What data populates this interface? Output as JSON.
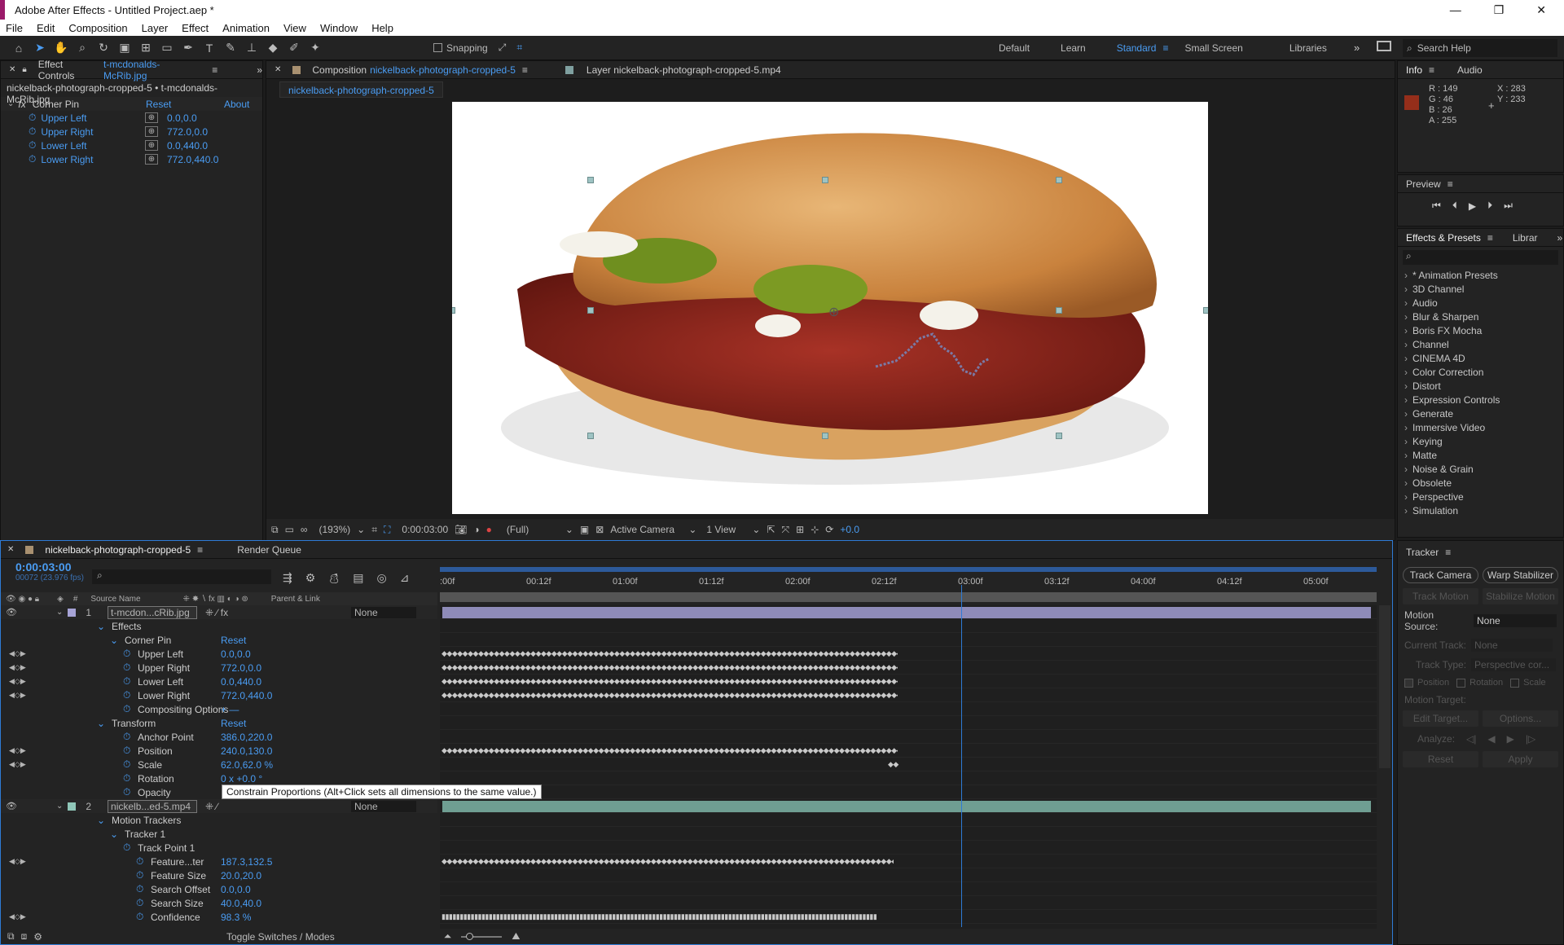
{
  "app": {
    "title": "Adobe After Effects - Untitled Project.aep *"
  },
  "menu": [
    "File",
    "Edit",
    "Composition",
    "Layer",
    "Effect",
    "Animation",
    "View",
    "Window",
    "Help"
  ],
  "toolbar": {
    "snapping": "Snapping",
    "workspaces": [
      "Default",
      "Learn",
      "Standard",
      "Small Screen",
      "Libraries"
    ],
    "search_placeholder": "Search Help"
  },
  "effect_controls": {
    "tab_prefix": "Effect Controls",
    "tab_name": "t-mcdonalds-McRib.jpg",
    "breadcrumb": "nickelback-photograph-cropped-5 • t-mcdonalds-McRib.jpg",
    "effect": "Corner Pin",
    "reset": "Reset",
    "about": "About",
    "params": [
      {
        "name": "Upper Left",
        "value": "0.0,0.0"
      },
      {
        "name": "Upper Right",
        "value": "772.0,0.0"
      },
      {
        "name": "Lower Left",
        "value": "0.0,440.0"
      },
      {
        "name": "Lower Right",
        "value": "772.0,440.0"
      }
    ]
  },
  "composition": {
    "tab_prefix": "Composition",
    "tab_name": "nickelback-photograph-cropped-5",
    "layer_tab": "Layer  nickelback-photograph-cropped-5.mp4",
    "subtab": "nickelback-photograph-cropped-5",
    "footer": {
      "zoom": "(193%)",
      "timecode": "0:00:03:00",
      "resolution": "(Full)",
      "camera": "Active Camera",
      "views": "1 View",
      "exposure": "+0.0"
    }
  },
  "info": {
    "tab1": "Info",
    "tab2": "Audio",
    "r": "R : 149",
    "g": "G : 46",
    "b": "B : 26",
    "a": "A : 255",
    "x": "X : 283",
    "y": "Y : 233",
    "color": "#95 2e1a"
  },
  "preview": {
    "title": "Preview"
  },
  "effects_presets": {
    "tab1": "Effects & Presets",
    "tab2": "Librar",
    "items": [
      "* Animation Presets",
      "3D Channel",
      "Audio",
      "Blur & Sharpen",
      "Boris FX Mocha",
      "Channel",
      "CINEMA 4D",
      "Color Correction",
      "Distort",
      "Expression Controls",
      "Generate",
      "Immersive Video",
      "Keying",
      "Matte",
      "Noise & Grain",
      "Obsolete",
      "Perspective",
      "Simulation"
    ]
  },
  "tracker": {
    "title": "Tracker",
    "track_camera": "Track Camera",
    "warp_stabilizer": "Warp Stabilizer",
    "track_motion": "Track Motion",
    "stabilize_motion": "Stabilize Motion",
    "motion_source_label": "Motion Source:",
    "motion_source": "None",
    "current_track_label": "Current Track:",
    "current_track": "None",
    "track_type_label": "Track Type:",
    "track_type": "Perspective cor...",
    "position": "Position",
    "rotation": "Rotation",
    "scale": "Scale",
    "motion_target": "Motion Target:",
    "edit_target": "Edit Target...",
    "options": "Options...",
    "analyze": "Analyze:",
    "reset": "Reset",
    "apply": "Apply"
  },
  "timeline": {
    "tab": "nickelback-photograph-cropped-5",
    "render_queue": "Render Queue",
    "timecode": "0:00:03:00",
    "frame_info": "00072 (23.976 fps)",
    "col_source": "Source Name",
    "col_parent": "Parent & Link",
    "ruler": [
      ":00f",
      "00:12f",
      "01:00f",
      "01:12f",
      "02:00f",
      "02:12f",
      "03:00f",
      "03:12f",
      "04:00f",
      "04:12f",
      "05:00f"
    ],
    "rows": [
      {
        "num": "1",
        "name": "t-mcdon...cRib.jpg",
        "parent": "None",
        "type": "layer"
      },
      {
        "label": "Effects",
        "indent": 1
      },
      {
        "label": "Corner Pin",
        "indent": 2,
        "value": "Reset"
      },
      {
        "label": "Upper Left",
        "indent": 3,
        "value": "0.0,0.0",
        "kf": true
      },
      {
        "label": "Upper Right",
        "indent": 3,
        "value": "772.0,0.0",
        "kf": true
      },
      {
        "label": "Lower Left",
        "indent": 3,
        "value": "0.0,440.0",
        "kf": true
      },
      {
        "label": "Lower Right",
        "indent": 3,
        "value": "772.0,440.0",
        "kf": true
      },
      {
        "label": "Compositing Options",
        "indent": 3,
        "value": "+ —"
      },
      {
        "label": "Transform",
        "indent": 1,
        "value": "Reset"
      },
      {
        "label": "Anchor Point",
        "indent": 3,
        "value": "386.0,220.0"
      },
      {
        "label": "Position",
        "indent": 3,
        "value": "240.0,130.0",
        "kf": true
      },
      {
        "label": "Scale",
        "indent": 3,
        "value": "62.0,62.0 %",
        "kf": true
      },
      {
        "label": "Rotation",
        "indent": 3,
        "value": "0 x +0.0 °"
      },
      {
        "label": "Opacity",
        "indent": 3,
        "value": ""
      },
      {
        "num": "2",
        "name": "nickelb...ed-5.mp4",
        "parent": "None",
        "type": "layer"
      },
      {
        "label": "Motion Trackers",
        "indent": 1
      },
      {
        "label": "Tracker 1",
        "indent": 2
      },
      {
        "label": "Track Point 1",
        "indent": 3
      },
      {
        "label": "Feature...ter",
        "indent": 4,
        "value": "187.3,132.5",
        "kf": true
      },
      {
        "label": "Feature Size",
        "indent": 4,
        "value": "20.0,20.0"
      },
      {
        "label": "Search Offset",
        "indent": 4,
        "value": "0.0,0.0"
      },
      {
        "label": "Search Size",
        "indent": 4,
        "value": "40.0,40.0"
      },
      {
        "label": "Confidence",
        "indent": 4,
        "value": "98.3 %",
        "kf": true
      }
    ],
    "tooltip": "Constrain Proportions (Alt+Click sets all dimensions to the same value.)",
    "toggle": "Toggle Switches / Modes"
  }
}
